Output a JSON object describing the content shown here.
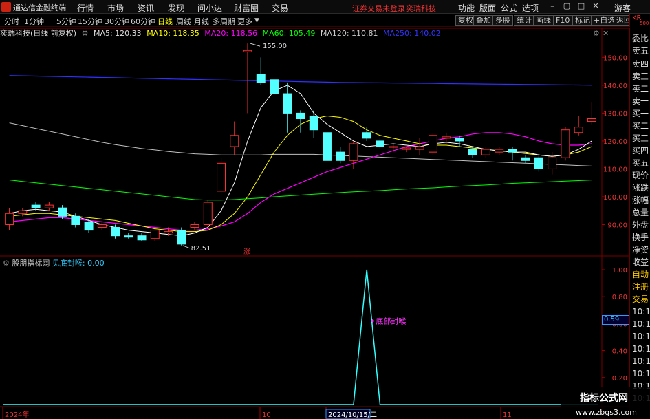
{
  "app": {
    "title": "通达信金融终端"
  },
  "menu": [
    "行情",
    "市场",
    "资讯",
    "发现",
    "问小达",
    "财富圈",
    "交易"
  ],
  "status": {
    "account": "证券交易未登录",
    "stock": "奕瑞科技"
  },
  "right_menu": [
    "功能",
    "版面",
    "公式",
    "选项"
  ],
  "guest": "游客",
  "timeframes": [
    "分时",
    "1分钟",
    "5分钟",
    "15分钟",
    "30分钟",
    "60分钟",
    "日线",
    "周线",
    "月线",
    "多周期",
    "更多"
  ],
  "active_timeframe": "日线",
  "tool_buttons": [
    "复权",
    "叠加",
    "多股",
    "统计",
    "画线",
    "F10",
    "标记",
    "+自选",
    "返回"
  ],
  "kr": {
    "top": "KR",
    "sub": "500"
  },
  "chart_info": {
    "name": "奕瑞科技(日线 前复权)",
    "ma5": "MA5: 120.33",
    "ma10": "MA10: 118.35",
    "ma20": "MA20: 118.56",
    "ma60": "MA60: 105.49",
    "ma120": "MA120: 110.81",
    "ma250": "MA250: 140.02"
  },
  "price_axis": [
    "150.00",
    "140.00",
    "130.00",
    "120.00",
    "110.00",
    "100.00",
    "90.00"
  ],
  "annotations": {
    "high": "155.00",
    "low": "82.51",
    "zhang": "涨"
  },
  "right_panel": [
    "委比",
    "卖五",
    "卖四",
    "卖三",
    "卖二",
    "卖一",
    "买一",
    "买二",
    "买三",
    "买四",
    "买五",
    "现价",
    "涨跌",
    "涨幅",
    "总量",
    "外盘",
    "换手",
    "净资",
    "收益",
    "自动",
    "注册",
    "交易",
    "10:1",
    "10:1",
    "10:1",
    "10:1",
    "10:1",
    "10:1",
    "10:1",
    "10:1"
  ],
  "indicator": {
    "name": "股朋指标网",
    "line": "见底封喉: 0.00",
    "signal": "底部封喉",
    "axis": [
      "1.00",
      "0.80",
      "0.60",
      "0.40",
      "0.20"
    ],
    "value": "0.59"
  },
  "date_axis": [
    "2024年",
    "10",
    "2024/10/15/二",
    "11"
  ],
  "watermark": {
    "title": "指标公式网",
    "url": "www.zbgs3.com"
  },
  "colors": {
    "up": "#ff3232",
    "down": "#54ffff",
    "ma5": "#ffffff",
    "ma10": "#ffff00",
    "ma20": "#ff00ff",
    "ma60": "#00ff00",
    "ma120": "#c0c0c0",
    "ma250": "#3030ff"
  },
  "chart_data": {
    "type": "candlestick",
    "ylim": [
      80,
      157
    ],
    "candles": [
      {
        "o": 90,
        "c": 94,
        "h": 96,
        "l": 88
      },
      {
        "o": 94,
        "c": 95,
        "h": 96,
        "l": 93
      },
      {
        "o": 97,
        "c": 96,
        "h": 98,
        "l": 95
      },
      {
        "o": 96,
        "c": 97,
        "h": 98,
        "l": 95
      },
      {
        "o": 96,
        "c": 93,
        "h": 97,
        "l": 92
      },
      {
        "o": 93,
        "c": 90,
        "h": 94,
        "l": 89
      },
      {
        "o": 91,
        "c": 88,
        "h": 92,
        "l": 87
      },
      {
        "o": 89,
        "c": 90,
        "h": 91,
        "l": 88
      },
      {
        "o": 89,
        "c": 86,
        "h": 90,
        "l": 85
      },
      {
        "o": 86,
        "c": 85.5,
        "h": 87,
        "l": 85
      },
      {
        "o": 86,
        "c": 84.5,
        "h": 87,
        "l": 84
      },
      {
        "o": 85,
        "c": 88,
        "h": 89,
        "l": 84
      },
      {
        "o": 87,
        "c": 87.5,
        "h": 89,
        "l": 86
      },
      {
        "o": 88,
        "c": 83,
        "h": 89,
        "l": 82.51
      },
      {
        "o": 89,
        "c": 90,
        "h": 91,
        "l": 88
      },
      {
        "o": 90,
        "c": 98,
        "h": 99,
        "l": 89
      },
      {
        "o": 102,
        "c": 112,
        "h": 114,
        "l": 101
      },
      {
        "o": 118,
        "c": 122,
        "h": 127,
        "l": 115
      },
      {
        "o": 152,
        "c": 152.5,
        "h": 155,
        "l": 130
      },
      {
        "o": 144,
        "c": 141,
        "h": 150,
        "l": 140
      },
      {
        "o": 142,
        "c": 137,
        "h": 145,
        "l": 132
      },
      {
        "o": 137,
        "c": 130,
        "h": 141,
        "l": 123
      },
      {
        "o": 130,
        "c": 128,
        "h": 131,
        "l": 123
      },
      {
        "o": 129,
        "c": 124,
        "h": 131,
        "l": 121
      },
      {
        "o": 123,
        "c": 113,
        "h": 125,
        "l": 112
      },
      {
        "o": 116,
        "c": 113,
        "h": 118,
        "l": 112
      },
      {
        "o": 113,
        "c": 119,
        "h": 120,
        "l": 110
      },
      {
        "o": 123,
        "c": 121,
        "h": 125,
        "l": 120
      },
      {
        "o": 120,
        "c": 118,
        "h": 121,
        "l": 117
      },
      {
        "o": 118,
        "c": 118,
        "h": 119,
        "l": 116
      },
      {
        "o": 117,
        "c": 117.5,
        "h": 118,
        "l": 116
      },
      {
        "o": 117,
        "c": 118,
        "h": 121,
        "l": 115
      },
      {
        "o": 116,
        "c": 122,
        "h": 123,
        "l": 115
      },
      {
        "o": 121,
        "c": 121.5,
        "h": 123,
        "l": 119
      },
      {
        "o": 121,
        "c": 120,
        "h": 122,
        "l": 118
      },
      {
        "o": 117,
        "c": 115,
        "h": 118,
        "l": 114
      },
      {
        "o": 115,
        "c": 117,
        "h": 118,
        "l": 114
      },
      {
        "o": 116,
        "c": 117,
        "h": 118,
        "l": 115
      },
      {
        "o": 117,
        "c": 116,
        "h": 118,
        "l": 113
      },
      {
        "o": 114,
        "c": 113,
        "h": 115,
        "l": 112
      },
      {
        "o": 114,
        "c": 110,
        "h": 115,
        "l": 109
      },
      {
        "o": 110,
        "c": 114,
        "h": 116,
        "l": 108
      },
      {
        "o": 114,
        "c": 124,
        "h": 125,
        "l": 113
      },
      {
        "o": 123,
        "c": 125,
        "h": 129,
        "l": 122
      },
      {
        "o": 127,
        "c": 128,
        "h": 134,
        "l": 126
      }
    ],
    "ma5": [
      94,
      95,
      95.5,
      95,
      94.5,
      93,
      91.5,
      90,
      89,
      88,
      87.5,
      87,
      86.5,
      86,
      87,
      89,
      95,
      105,
      120,
      132,
      138,
      140,
      137,
      130,
      126,
      123,
      120,
      118,
      118.5,
      119,
      118.5,
      118,
      119,
      119.5,
      119,
      118,
      117,
      116.5,
      116,
      116,
      115,
      114.5,
      115,
      117,
      120
    ],
    "ma10": [
      93,
      93.5,
      94,
      94,
      93.5,
      93,
      92.5,
      92,
      91.5,
      90.5,
      89.5,
      88.5,
      88,
      87.5,
      87.5,
      88,
      90,
      94,
      100,
      108,
      116,
      122,
      126,
      128,
      129,
      128.5,
      127,
      124,
      122,
      121,
      120,
      119,
      118.5,
      118.5,
      118,
      117.5,
      117,
      116.5,
      116,
      115.5,
      115,
      114.5,
      115,
      116,
      118
    ],
    "ma20": [
      91,
      91.5,
      92,
      92.5,
      92.5,
      92,
      91.5,
      91,
      90.5,
      90,
      89.5,
      89,
      88.5,
      88,
      88,
      88.5,
      89.5,
      91,
      94,
      98,
      101,
      103,
      105,
      107,
      109,
      110.5,
      112,
      113.5,
      115,
      116.5,
      118,
      119,
      120,
      121,
      121.5,
      122.5,
      123,
      123,
      122.5,
      121.5,
      120,
      119,
      118.5,
      118.5,
      119
    ],
    "ma60": [
      106,
      105.5,
      105,
      104.5,
      104,
      103.5,
      103,
      102.5,
      102,
      101.5,
      101,
      100.5,
      100,
      99.5,
      99,
      98.8,
      98.8,
      99,
      99.3,
      99.6,
      100,
      100.3,
      100.6,
      100.9,
      101.2,
      101.5,
      101.8,
      102,
      102.2,
      102.5,
      102.8,
      103,
      103.2,
      103.5,
      103.8,
      104,
      104.2,
      104.5,
      104.8,
      105,
      105.2,
      105.4,
      105.6,
      105.8,
      106
    ],
    "ma120": [
      126.5,
      125.5,
      124.5,
      123.5,
      122.5,
      121.5,
      120.5,
      119.5,
      118.7,
      118,
      117.3,
      116.8,
      116.2,
      115.8,
      115.4,
      115.2,
      115,
      115,
      115,
      115,
      115.2,
      115.2,
      115.2,
      115.2,
      115,
      114.8,
      114.6,
      114.4,
      114.2,
      114,
      113.8,
      113.6,
      113.4,
      113.2,
      113,
      112.8,
      112.6,
      112.4,
      112.2,
      112,
      111.8,
      111.6,
      111.4,
      111.2,
      111
    ],
    "ma250": [
      143.5,
      143.4,
      143.3,
      143.2,
      143.1,
      143,
      142.9,
      142.8,
      142.7,
      142.6,
      142.5,
      142.4,
      142.3,
      142.2,
      142.1,
      142,
      141.9,
      141.8,
      141.7,
      141.6,
      141.5,
      141.4,
      141.3,
      141.2,
      141.1,
      141,
      140.95,
      140.9,
      140.85,
      140.8,
      140.75,
      140.7,
      140.65,
      140.6,
      140.55,
      140.5,
      140.45,
      140.4,
      140.35,
      140.3,
      140.25,
      140.2,
      140.15,
      140.1,
      140.02
    ],
    "indicator_values": [
      0,
      0,
      0,
      0,
      0,
      0,
      0,
      0,
      0,
      0,
      0,
      0,
      0,
      0,
      0,
      0,
      0,
      0,
      0,
      0,
      0,
      0,
      0,
      0,
      0,
      0,
      0,
      1,
      0,
      0,
      0,
      0,
      0,
      0,
      0,
      0,
      0,
      0,
      0,
      0,
      0,
      0,
      0,
      0,
      0
    ]
  }
}
